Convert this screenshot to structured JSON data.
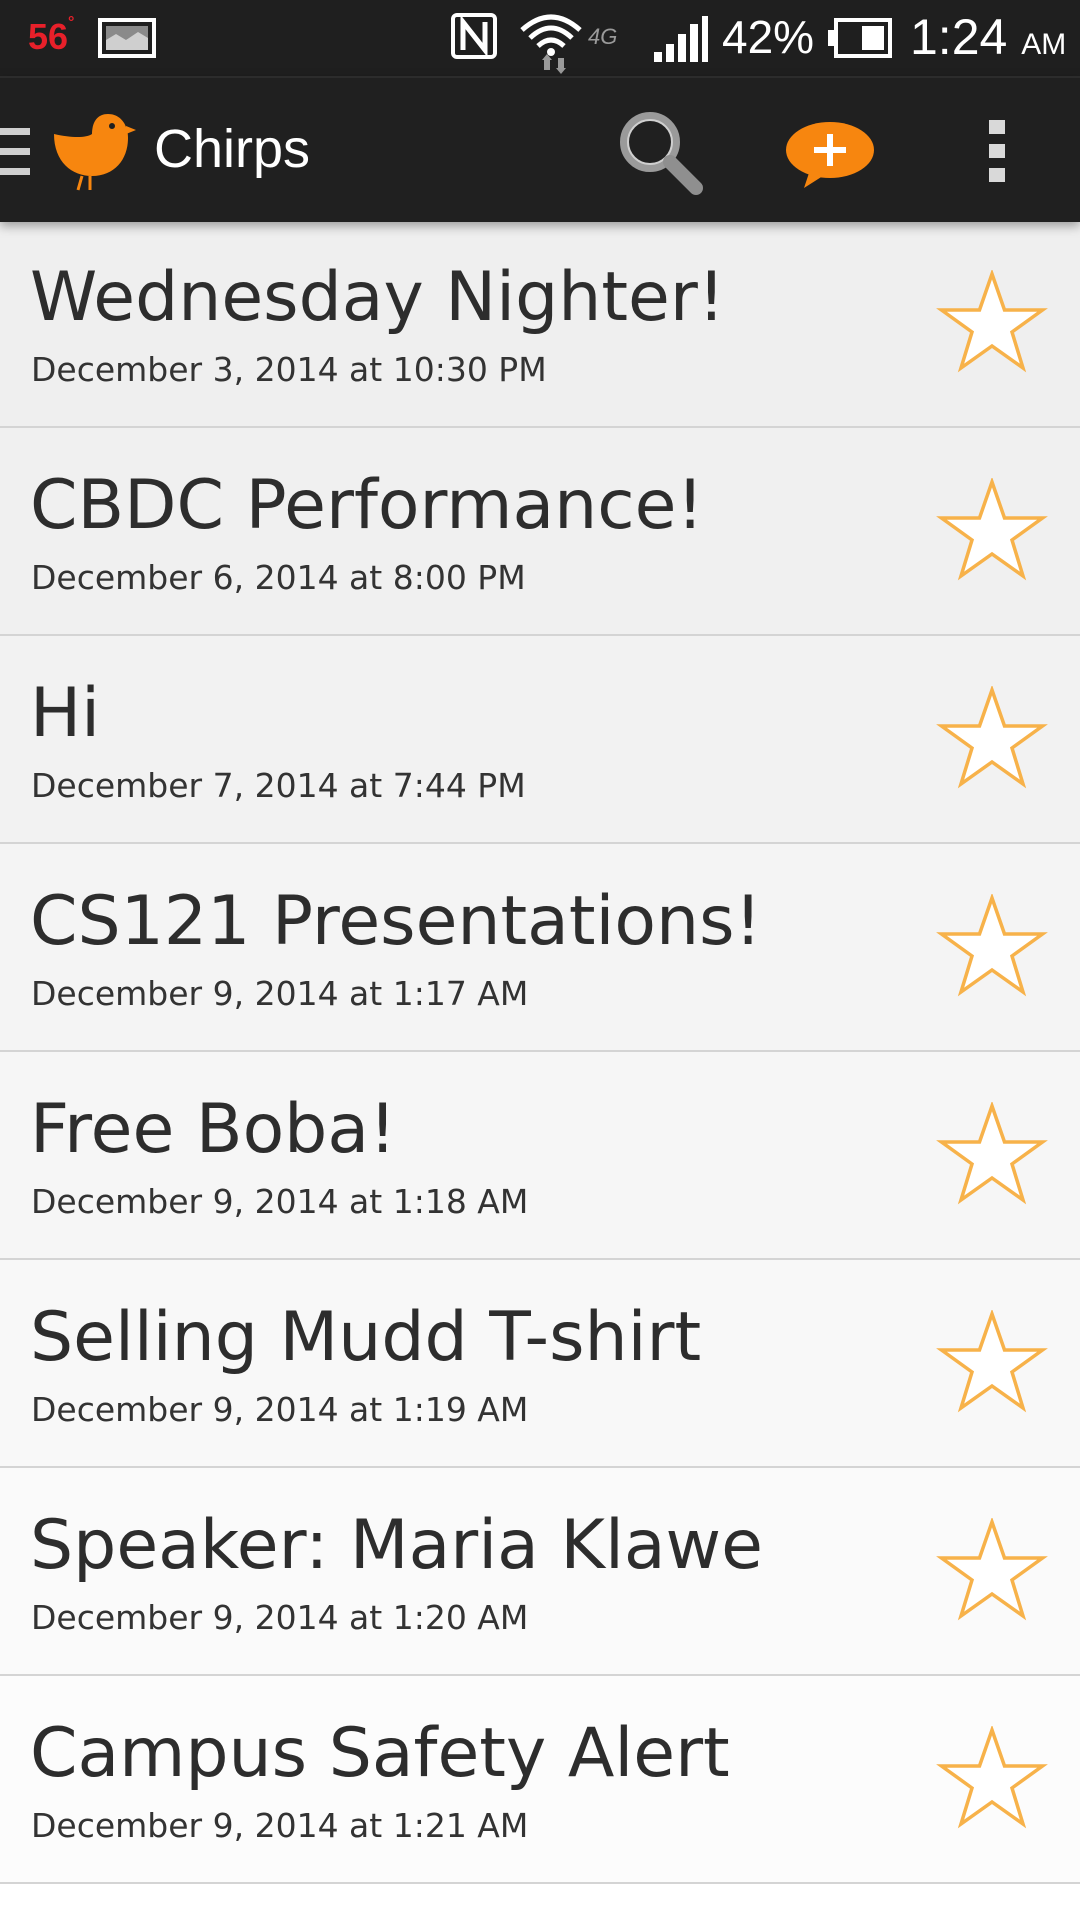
{
  "status_bar": {
    "temperature": "56",
    "temperature_unit": "°",
    "network": "4G",
    "battery_percent": "42%",
    "time": "1:24",
    "ampm": "AM",
    "icons": [
      "gallery-icon",
      "nfc-icon",
      "wifi-icon",
      "signal-icon",
      "battery-icon"
    ]
  },
  "app_bar": {
    "title": "Chirps",
    "icons": [
      "drawer-icon",
      "bird-logo-icon",
      "search-icon",
      "add-chirp-icon",
      "overflow-menu-icon"
    ],
    "accent_color": "#f7860f"
  },
  "chirps": [
    {
      "title": "Wednesday Nighter!",
      "date": "December 3, 2014 at 10:30 PM"
    },
    {
      "title": "CBDC Performance!",
      "date": "December 6, 2014 at 8:00 PM"
    },
    {
      "title": "Hi",
      "date": "December 7, 2014 at 7:44 PM"
    },
    {
      "title": "CS121 Presentations!",
      "date": "December 9, 2014 at 1:17 AM"
    },
    {
      "title": "Free Boba!",
      "date": "December 9, 2014 at 1:18 AM"
    },
    {
      "title": "Selling Mudd T-shirt",
      "date": "December 9, 2014 at 1:19 AM"
    },
    {
      "title": "Speaker: Maria Klawe",
      "date": "December 9, 2014 at 1:20 AM"
    },
    {
      "title": "Campus Safety Alert",
      "date": "December 9, 2014 at 1:21 AM"
    }
  ],
  "star_icon": "star-outline-icon",
  "star_color": "#f7b24a"
}
